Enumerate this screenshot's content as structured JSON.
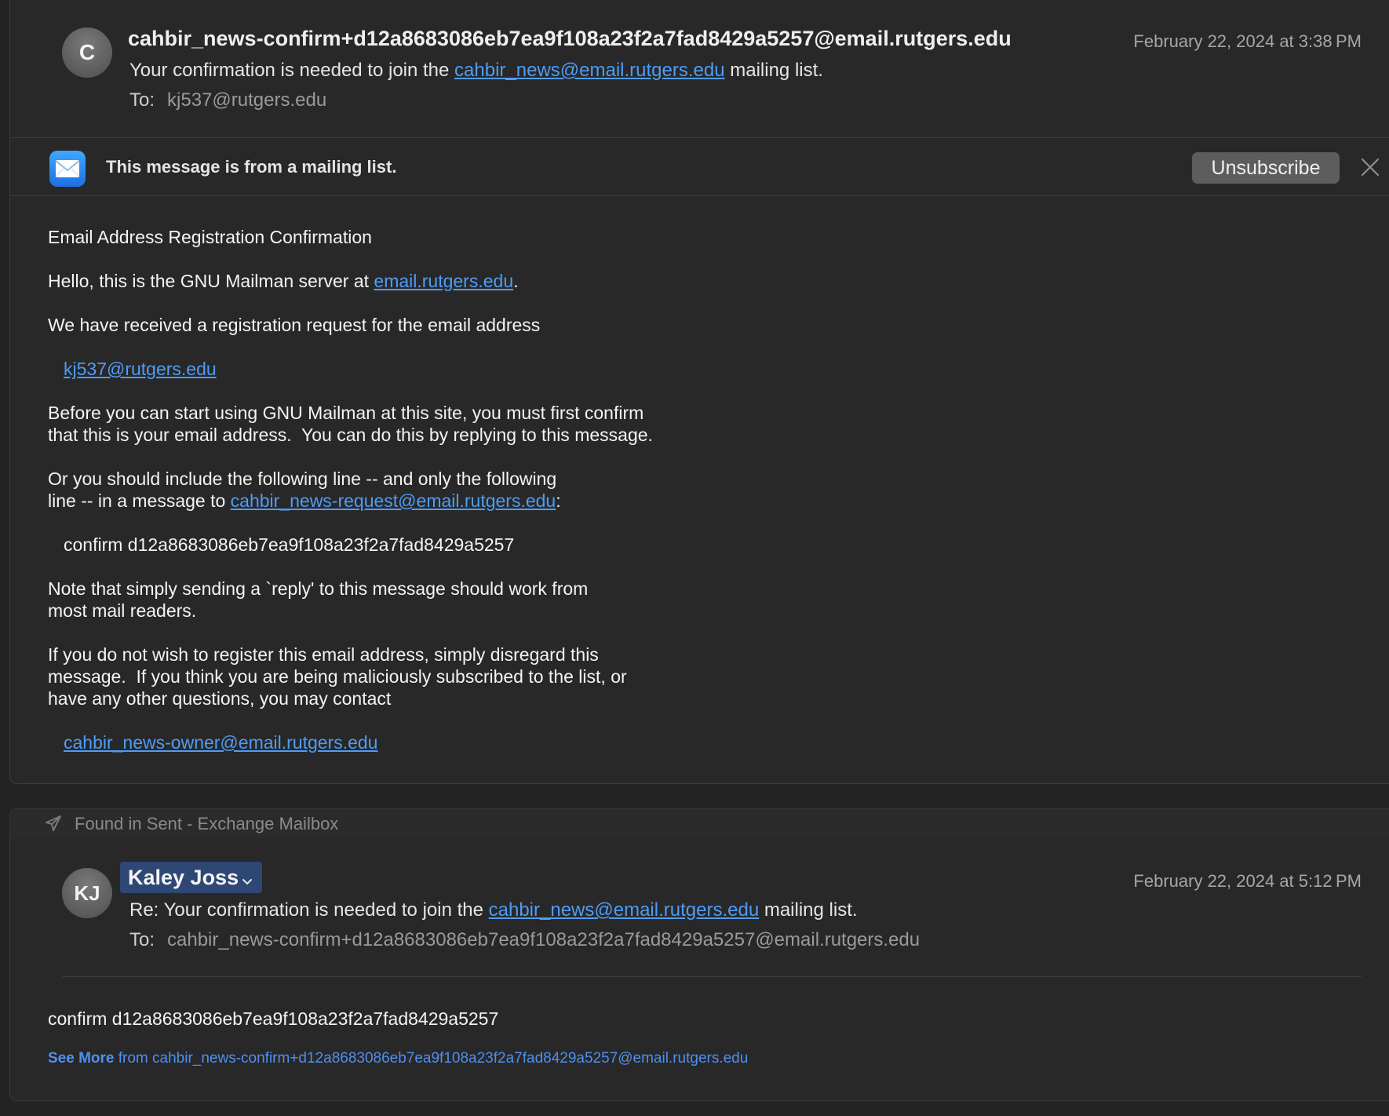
{
  "message1": {
    "avatar_initial": "C",
    "from": "cahbir_news-confirm+d12a8683086eb7ea9f108a23f2a7fad8429a5257@email.rutgers.edu",
    "date": "February 22, 2024 at 3:38 PM",
    "subject_prefix": "Your confirmation is needed to join the ",
    "subject_link": "cahbir_news@email.rutgers.edu",
    "subject_suffix": " mailing list.",
    "to_label": "To:",
    "to": "kj537@rutgers.edu",
    "banner_text": "This message is from a mailing list.",
    "unsubscribe_label": "Unsubscribe",
    "body": {
      "title": "Email Address Registration Confirmation",
      "hello_prefix": "Hello, this is the GNU Mailman server at ",
      "hello_link": "email.rutgers.edu",
      "hello_suffix": ".",
      "received": "We have received a registration request for the email address",
      "address_link": "kj537@rutgers.edu",
      "before_line1": "Before you can start using GNU Mailman at this site, you must first confirm",
      "before_line2": "that this is your email address.  You can do this by replying to this message.",
      "or_line1": "Or you should include the following line -- and only the following",
      "or_line2_prefix": "line -- in a message to ",
      "or_line2_link": "cahbir_news-request@email.rutgers.edu",
      "or_line2_suffix": ":",
      "confirm_line": "confirm d12a8683086eb7ea9f108a23f2a7fad8429a5257",
      "note_line1": "Note that simply sending a `reply' to this message should work from",
      "note_line2": "most mail readers.",
      "if_line1": "If you do not wish to register this email address, simply disregard this",
      "if_line2": "message.  If you think you are being maliciously subscribed to the list, or",
      "if_line3": "have any other questions, you may contact",
      "owner_link": "cahbir_news-owner@email.rutgers.edu"
    }
  },
  "found_in": "Found in Sent - Exchange Mailbox",
  "message2": {
    "avatar_initials": "KJ",
    "from": "Kaley Joss",
    "date": "February 22, 2024 at 5:12 PM",
    "subject_prefix": "Re: Your confirmation is needed to join the ",
    "subject_link": "cahbir_news@email.rutgers.edu",
    "subject_suffix": " mailing list.",
    "to_label": "To:",
    "to": "cahbir_news-confirm+d12a8683086eb7ea9f108a23f2a7fad8429a5257@email.rutgers.edu",
    "body_line": "confirm d12a8683086eb7ea9f108a23f2a7fad8429a5257",
    "see_more_bold": "See More",
    "see_more_rest": " from cahbir_news-confirm+d12a8683086eb7ea9f108a23f2a7fad8429a5257@email.rutgers.edu"
  },
  "colors": {
    "background": "#232323",
    "card": "#282828",
    "link": "#4f9cf5",
    "sender_pill": "#2e4775",
    "unsubscribe_button": "#5d5d5d"
  },
  "icons": [
    "envelope-icon",
    "close-icon",
    "paper-plane-icon",
    "chevron-down-icon"
  ]
}
